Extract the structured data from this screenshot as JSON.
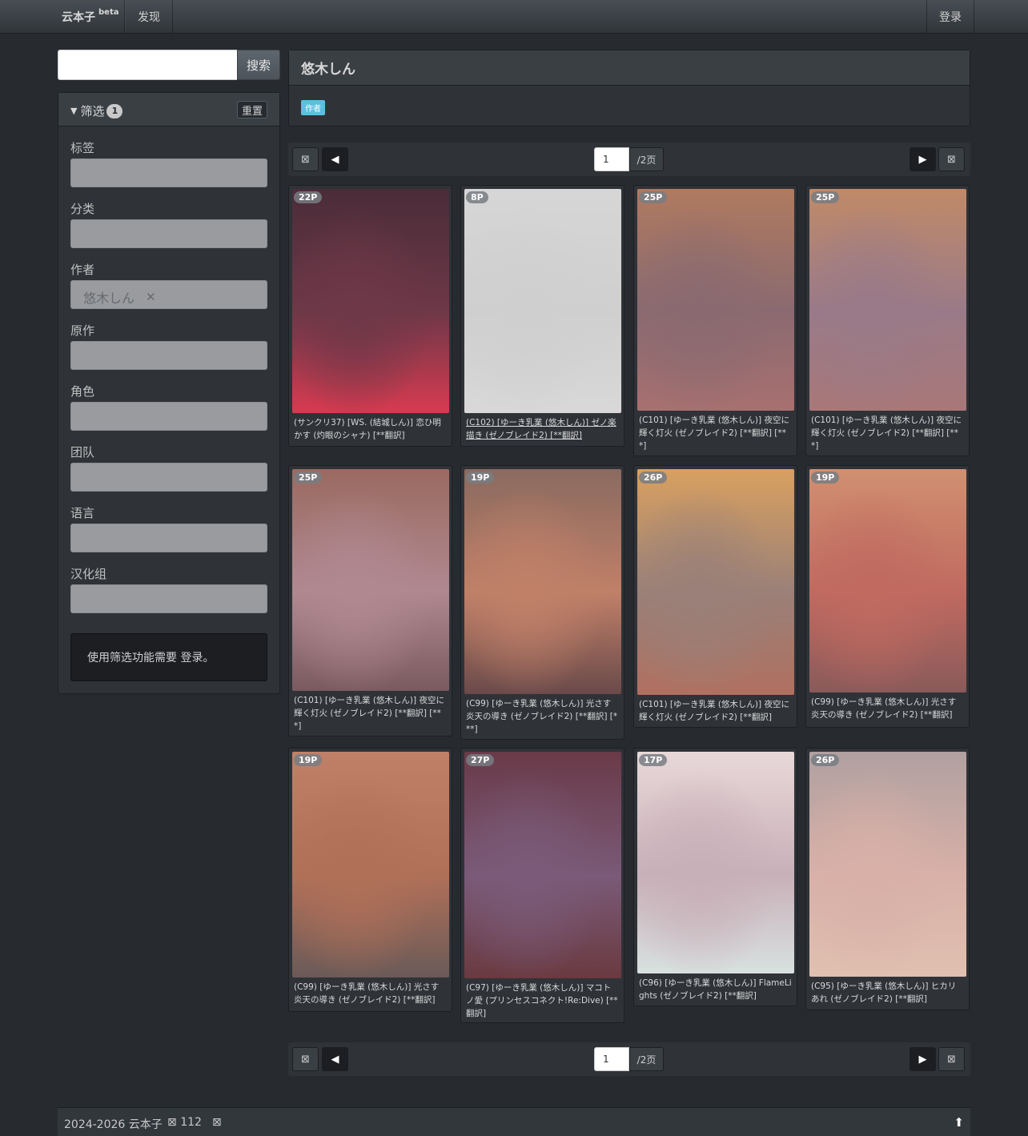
{
  "navbar": {
    "brand": "云本子",
    "brand_sup": "beta",
    "discover": "发现",
    "login": "登录"
  },
  "search": {
    "value": "",
    "button": "搜索"
  },
  "filter": {
    "title": "筛选",
    "count": "1",
    "reset": "重置",
    "fields": [
      {
        "label": "标签",
        "value": ""
      },
      {
        "label": "分类",
        "value": ""
      },
      {
        "label": "作者",
        "value": "悠木しん"
      },
      {
        "label": "原作",
        "value": ""
      },
      {
        "label": "角色",
        "value": ""
      },
      {
        "label": "团队",
        "value": ""
      },
      {
        "label": "语言",
        "value": ""
      },
      {
        "label": "汉化组",
        "value": ""
      }
    ],
    "login_note": "使用筛选功能需要 登录。"
  },
  "author": {
    "name": "悠木しん",
    "tag": "作者"
  },
  "pager": {
    "page": "1",
    "total": "/2页",
    "first_icon": "first-page-icon",
    "prev_icon": "prev-icon",
    "next_icon": "next-icon",
    "last_icon": "last-page-icon"
  },
  "cards": [
    {
      "pages": "22P",
      "title": "(サンクリ37) [WS. (結城しん)] 恋ひ明かす (灼眼のシャナ) [**翻訳]",
      "colors": [
        "#4a2c38",
        "#6e3848",
        "#d83a50"
      ]
    },
    {
      "pages": "8P",
      "title": "(C102) [ゆーき乳業 (悠木しん)] ゼノ楽描き (ゼノブレイド2) [**翻訳]",
      "colors": [
        "#d6d6d6",
        "#cfcfcf",
        "#d8d8d8"
      ]
    },
    {
      "pages": "25P",
      "title": "(C101) [ゆーき乳業 (悠木しん)] 夜空に輝く灯火 (ゼノブレイド2) [**翻訳] [***]",
      "colors": [
        "#b07a60",
        "#8a6a70",
        "#a87070"
      ]
    },
    {
      "pages": "25P",
      "title": "(C101) [ゆーき乳業 (悠木しん)] 夜空に輝く灯火 (ゼノブレイド2) [**翻訳] [***]",
      "colors": [
        "#c08a68",
        "#9a7a88",
        "#a87878"
      ]
    },
    {
      "pages": "25P",
      "title": "(C101) [ゆーき乳業 (悠木しん)] 夜空に輝く灯火 (ゼノブレイド2) [**翻訳] [***]",
      "colors": [
        "#9a6a60",
        "#b08890",
        "#7a5a60"
      ]
    },
    {
      "pages": "19P",
      "title": "(C99) [ゆーき乳業 (悠木しん)] 光さす炎天の導き (ゼノブレイド2) [**翻訳] [***]",
      "colors": [
        "#8a6a60",
        "#c08068",
        "#6a4a4a"
      ]
    },
    {
      "pages": "26P",
      "title": "(C101) [ゆーき乳業 (悠木しん)] 夜空に輝く灯火 (ゼノブレイド2) [**翻訳]",
      "colors": [
        "#d8a060",
        "#9a8078",
        "#b07060"
      ]
    },
    {
      "pages": "19P",
      "title": "(C99) [ゆーき乳業 (悠木しん)] 光さす炎天の導き (ゼノブレイド2) [**翻訳]",
      "colors": [
        "#d09070",
        "#c06a60",
        "#8a5a5a"
      ]
    },
    {
      "pages": "19P",
      "title": "(C99) [ゆーき乳業 (悠木しん)] 光さす炎天の導き (ゼノブレイド2) [**翻訳]",
      "colors": [
        "#c08068",
        "#b07058",
        "#6a5a58"
      ]
    },
    {
      "pages": "27P",
      "title": "(C97) [ゆーき乳業 (悠木しん)] マコトノ愛 (プリンセスコネクト!Re:Dive) [**翻訳]",
      "colors": [
        "#6a3a48",
        "#7a5a78",
        "#6a3a40"
      ]
    },
    {
      "pages": "17P",
      "title": "(C96) [ゆーき乳業 (悠木しん)] FlameLights (ゼノブレイド2) [**翻訳]",
      "colors": [
        "#e8d8d8",
        "#c8b0b8",
        "#d8e0e0"
      ]
    },
    {
      "pages": "26P",
      "title": "(C95) [ゆーき乳業 (悠木しん)] ヒカリあれ (ゼノブレイド2) [**翻訳]",
      "colors": [
        "#b0a0a0",
        "#d8b0a8",
        "#e0c0b0"
      ]
    }
  ],
  "footer": {
    "copyright": "2024-2026 云本子",
    "views": "112",
    "views_icon": "eye-icon",
    "extra_icon": "misc-icon",
    "top_icon": "arrow-up-icon"
  }
}
